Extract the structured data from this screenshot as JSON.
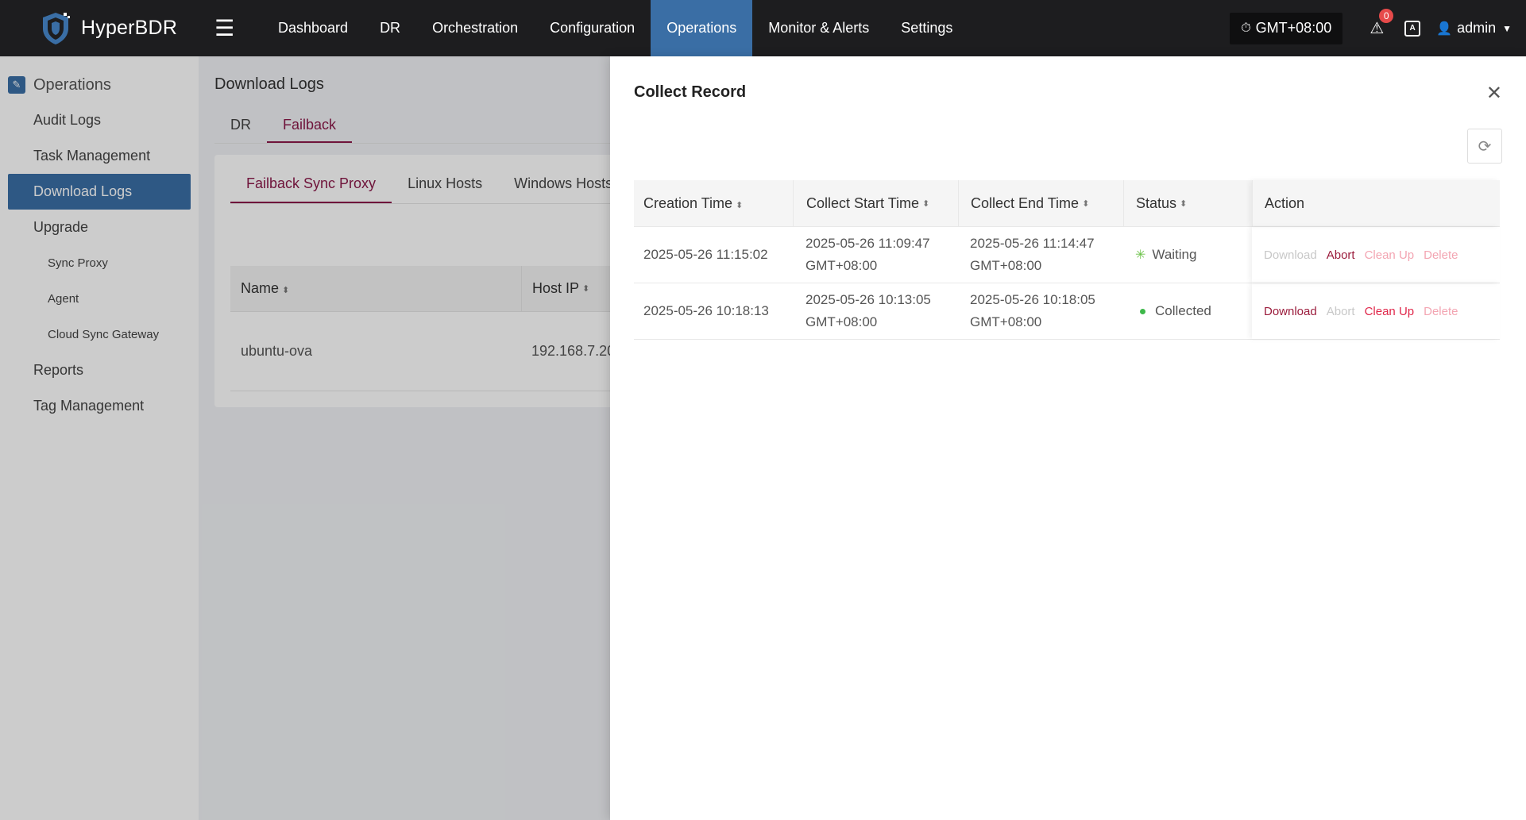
{
  "app": {
    "name": "HyperBDR"
  },
  "nav": {
    "items": [
      {
        "label": "Dashboard",
        "active": false
      },
      {
        "label": "DR",
        "active": false
      },
      {
        "label": "Orchestration",
        "active": false
      },
      {
        "label": "Configuration",
        "active": false
      },
      {
        "label": "Operations",
        "active": true
      },
      {
        "label": "Monitor & Alerts",
        "active": false
      },
      {
        "label": "Settings",
        "active": false
      }
    ],
    "timezone": "GMT+08:00",
    "alert_count": "0",
    "user": "admin"
  },
  "sidebar": {
    "heading": "Operations",
    "items": {
      "audit_logs": "Audit Logs",
      "task_management": "Task Management",
      "download_logs": "Download Logs",
      "upgrade": "Upgrade",
      "sync_proxy": "Sync Proxy",
      "agent": "Agent",
      "cloud_sync_gateway": "Cloud Sync Gateway",
      "reports": "Reports",
      "tag_management": "Tag Management"
    }
  },
  "main": {
    "title": "Download Logs",
    "tabs": {
      "dr": "DR",
      "failback": "Failback"
    },
    "subtabs": {
      "failback_sync_proxy": "Failback Sync Proxy",
      "linux_hosts": "Linux Hosts",
      "windows_hosts": "Windows Hosts"
    },
    "table": {
      "headers": {
        "name": "Name",
        "host_ip": "Host IP"
      },
      "row": {
        "name": "ubuntu-ova",
        "host_ip": "192.168.7.20"
      }
    }
  },
  "drawer": {
    "title": "Collect Record",
    "headers": {
      "creation_time": "Creation Time",
      "collect_start_time": "Collect Start Time",
      "collect_end_time": "Collect End Time",
      "status": "Status",
      "action": "Action"
    },
    "rows": [
      {
        "creation_time": "2025-05-26 11:15:02",
        "start_date": "2025-05-26 11:09:47",
        "start_tz": "GMT+08:00",
        "end_date": "2025-05-26 11:14:47",
        "end_tz": "GMT+08:00",
        "status": "Waiting"
      },
      {
        "creation_time": "2025-05-26 10:18:13",
        "start_date": "2025-05-26 10:13:05",
        "start_tz": "GMT+08:00",
        "end_date": "2025-05-26 10:18:05",
        "end_tz": "GMT+08:00",
        "status": "Collected"
      }
    ],
    "actions": {
      "download": "Download",
      "abort": "Abort",
      "clean_up": "Clean Up",
      "delete": "Delete"
    }
  }
}
